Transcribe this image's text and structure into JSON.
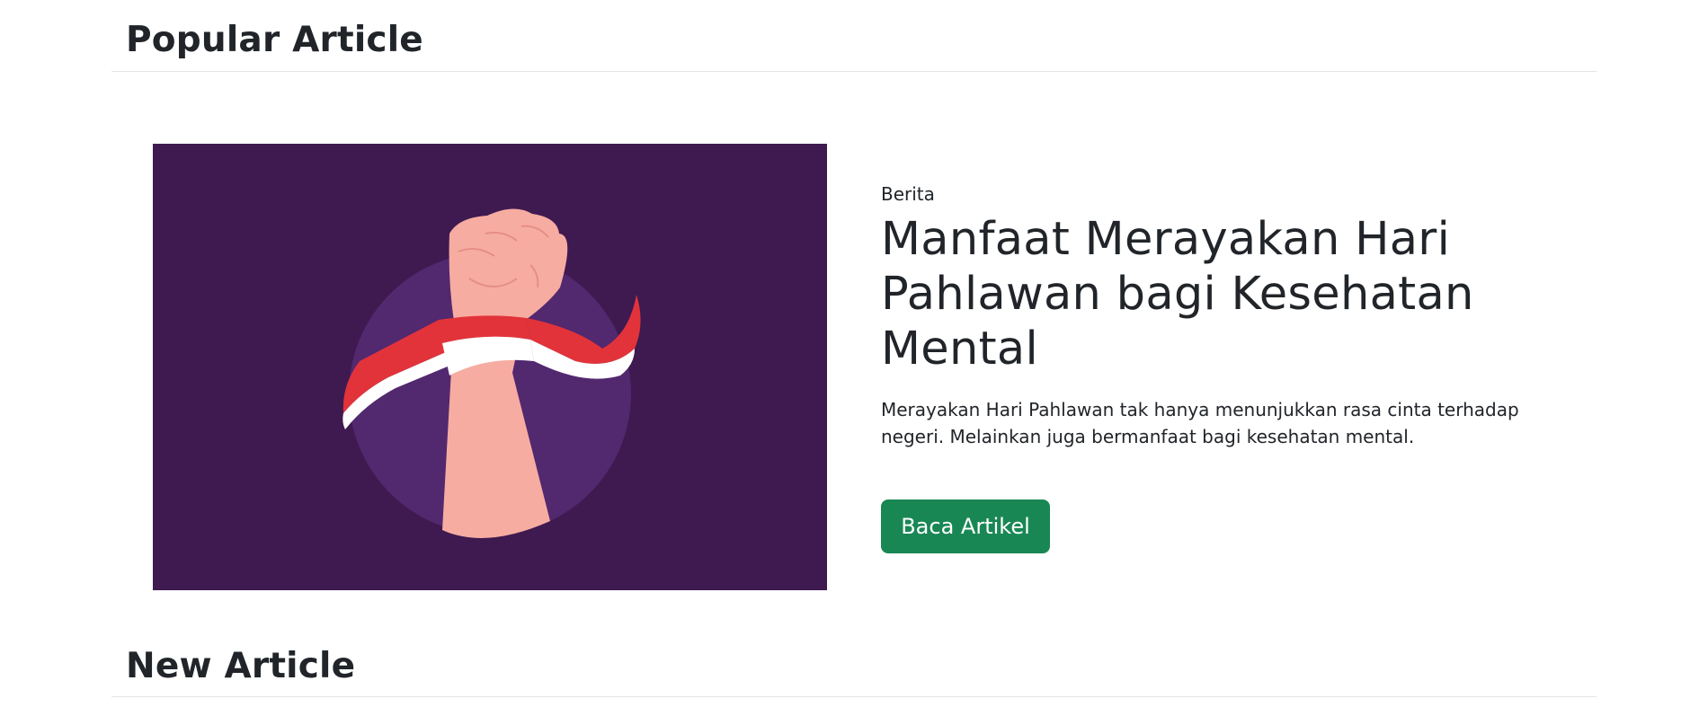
{
  "popular_section": {
    "title": "Popular Article"
  },
  "featured_article": {
    "category": "Berita",
    "title": "Manfaat Merayakan Hari Pahlawan bagi Kesehatan Mental",
    "excerpt": "Merayakan Hari Pahlawan tak hanya menunjukkan rasa cinta terhadap negeri. Melainkan juga bermanfaat bagi kesehatan mental.",
    "button_label": "Baca Artikel",
    "image": {
      "subject": "raised-fist-with-red-white-ribbon-illustration",
      "background_color": "#3e1a50",
      "circle_color": "#52286f",
      "skin_color": "#f7aca1",
      "ribbon_red": "#e2333a",
      "ribbon_white": "#ffffff"
    }
  },
  "new_section": {
    "title": "New Article"
  },
  "colors": {
    "accent_button": "#198754",
    "text": "#212529",
    "divider": "#e3e5e7"
  }
}
